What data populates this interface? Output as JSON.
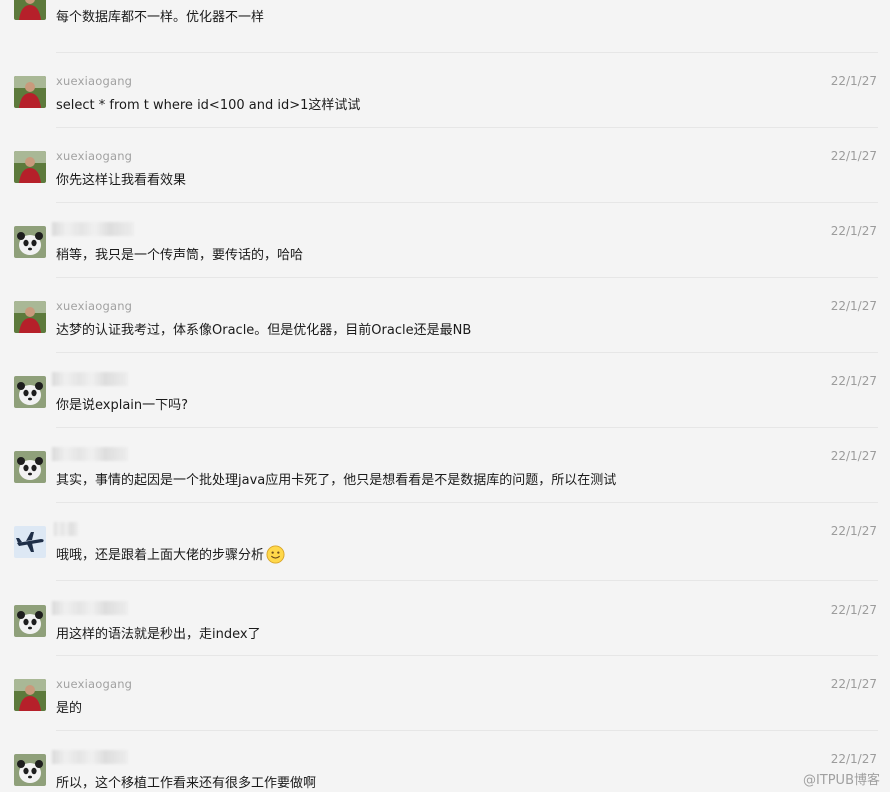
{
  "messages": [
    {
      "sender": "",
      "time": "",
      "text": "每个数据库都不一样。优化器不一样",
      "avatar": "person-red-avatar"
    },
    {
      "sender": "xuexiaogang",
      "time": "22/1/27",
      "text": "select * from t where id<100 and id>1这样试试",
      "avatar": "person-red-avatar"
    },
    {
      "sender": "xuexiaogang",
      "time": "22/1/27",
      "text": "你先这样让我看看效果",
      "avatar": "person-red-avatar"
    },
    {
      "sender": "",
      "time": "22/1/27",
      "text": "稍等，我只是一个传声筒，要传话的，哈哈",
      "avatar": "panda-avatar"
    },
    {
      "sender": "xuexiaogang",
      "time": "22/1/27",
      "text": "达梦的认证我考过，体系像Oracle。但是优化器，目前Oracle还是最NB",
      "avatar": "person-red-avatar"
    },
    {
      "sender": "",
      "time": "22/1/27",
      "text": "你是说explain一下吗?",
      "avatar": "panda-avatar"
    },
    {
      "sender": "",
      "time": "22/1/27",
      "text": "其实，事情的起因是一个批处理java应用卡死了，他只是想看看是不是数据库的问题，所以在测试",
      "avatar": "panda-avatar"
    },
    {
      "sender": "",
      "time": "22/1/27",
      "text": "哦哦，还是跟着上面大佬的步骤分析",
      "avatar": "airplane-avatar",
      "emoji": "smile-emoji"
    },
    {
      "sender": "",
      "time": "22/1/27",
      "text": "用这样的语法就是秒出，走index了",
      "avatar": "panda-avatar"
    },
    {
      "sender": "xuexiaogang",
      "time": "22/1/27",
      "text": "是的",
      "avatar": "person-red-avatar"
    },
    {
      "sender": "",
      "time": "22/1/27",
      "text": "所以，这个移植工作看来还有很多工作要做啊",
      "avatar": "panda-avatar"
    }
  ],
  "watermark": "@ITPUB博客"
}
